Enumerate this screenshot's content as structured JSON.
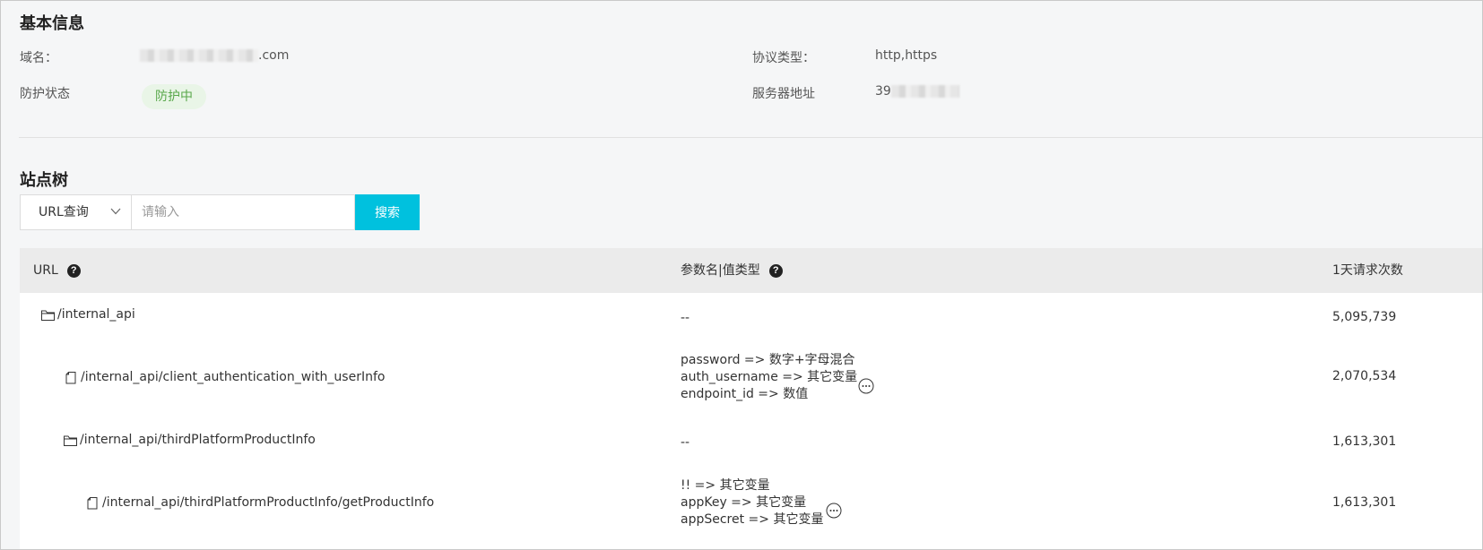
{
  "basic_info": {
    "title": "基本信息",
    "domain_label": "域名：",
    "domain_suffix": ".com",
    "protocol_label": "协议类型：",
    "protocol_value": "http,https",
    "status_label": "防护状态",
    "status_value": "防护中",
    "server_label": "服务器地址",
    "server_prefix": "39"
  },
  "site_tree": {
    "title": "站点树",
    "query_type": "URL查询",
    "search_placeholder": "请输入",
    "search_button": "搜索",
    "columns": {
      "url": "URL",
      "params": "参数名|值类型",
      "count": "1天请求次数"
    },
    "rows": [
      {
        "type": "folder",
        "url": "/internal_api",
        "params": [
          "--"
        ],
        "count": "5,095,739"
      },
      {
        "type": "file",
        "url": "/internal_api/client_authentication_with_userInfo",
        "params": [
          "password => 数字+字母混合",
          "auth_username => 其它变量",
          "endpoint_id => 数值"
        ],
        "count": "2,070,534"
      },
      {
        "type": "folder",
        "url": "/internal_api/thirdPlatformProductInfo",
        "params": [
          "--"
        ],
        "count": "1,613,301"
      },
      {
        "type": "file",
        "url": "/internal_api/thirdPlatformProductInfo/getProductInfo",
        "params": [
          "!! => 其它变量",
          "appKey => 其它变量",
          "appSecret => 其它变量"
        ],
        "count": "1,613,301"
      }
    ]
  },
  "colors": {
    "accent": "#00c1de",
    "status_bg": "#e9f5e7",
    "status_text": "#59a84b"
  },
  "icons": [
    "chevron-down-icon",
    "help-icon",
    "folder-icon",
    "file-icon",
    "more-icon"
  ]
}
